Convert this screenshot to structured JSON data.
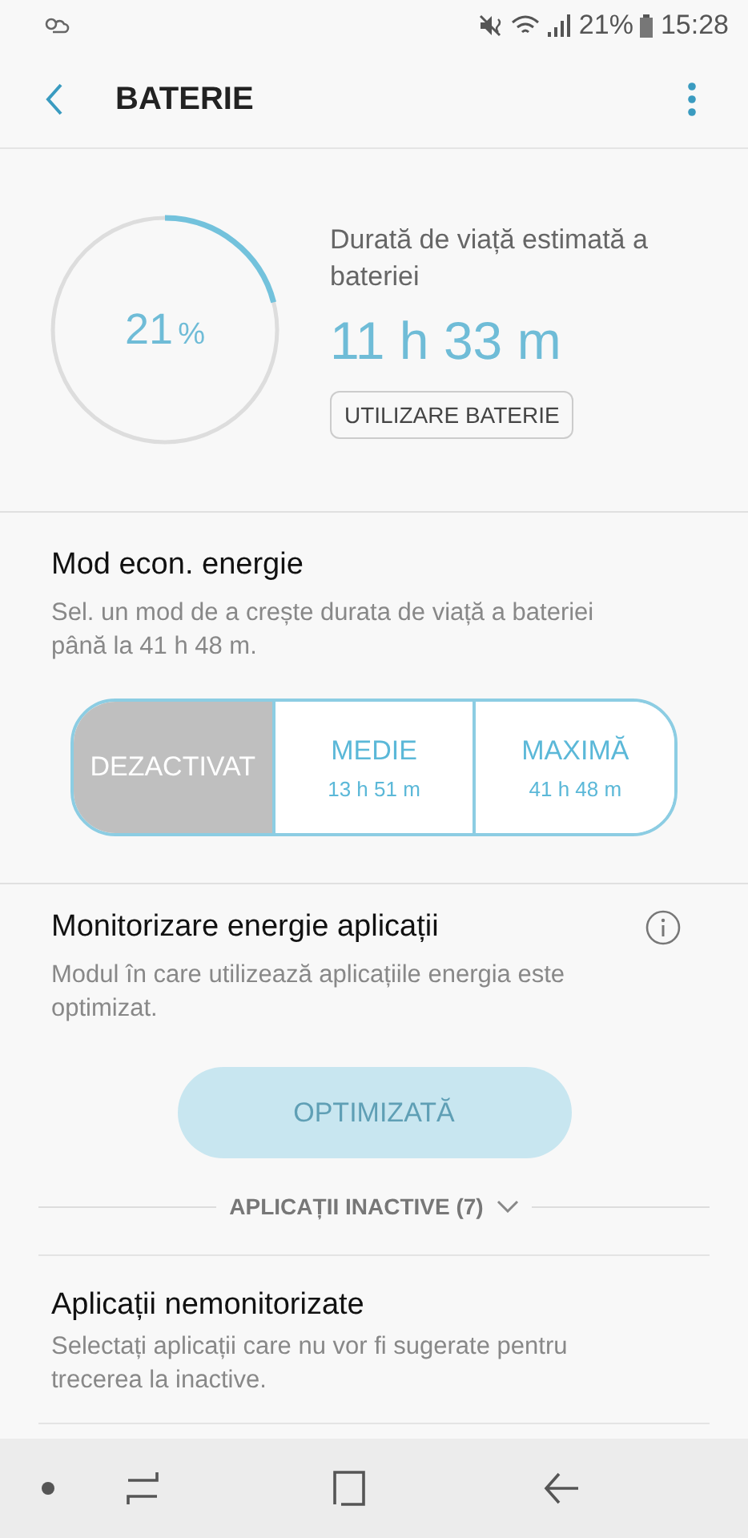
{
  "status_bar": {
    "battery_text": "21%",
    "time": "15:28"
  },
  "app_bar": {
    "title": "BATERIE"
  },
  "battery": {
    "level": 0.21,
    "percent": "21",
    "percent_sign": "%",
    "estimate_label": "Durată de viață estimată a bateriei",
    "estimate": "11 h 33 m",
    "usage_button": "UTILIZARE BATERIE"
  },
  "power_saving": {
    "title": "Mod econ. energie",
    "description": "Sel. un mod de a crește durata de viață a bateriei până la 41 h 48 m.",
    "modes": [
      {
        "label": "DEZACTIVAT",
        "selected": true
      },
      {
        "label": "MEDIE",
        "time": "13 h 51 m",
        "selected": false
      },
      {
        "label": "MAXIMĂ",
        "time": "41 h 48 m",
        "selected": false
      }
    ]
  },
  "app_monitor": {
    "title": "Monitorizare energie aplicații",
    "description": "Modul în care utilizează aplicațiile energia este optimizat.",
    "button": {
      "label": "OPTIMIZATĂ",
      "disabled": true
    },
    "inactive_apps": "APLICAȚII INACTIVE (7)"
  },
  "unmonitored": {
    "title": "Aplicații nemonitorizate",
    "description": "Selectați aplicații care nu vor fi sugerate pentru trecerea la inactive."
  }
}
